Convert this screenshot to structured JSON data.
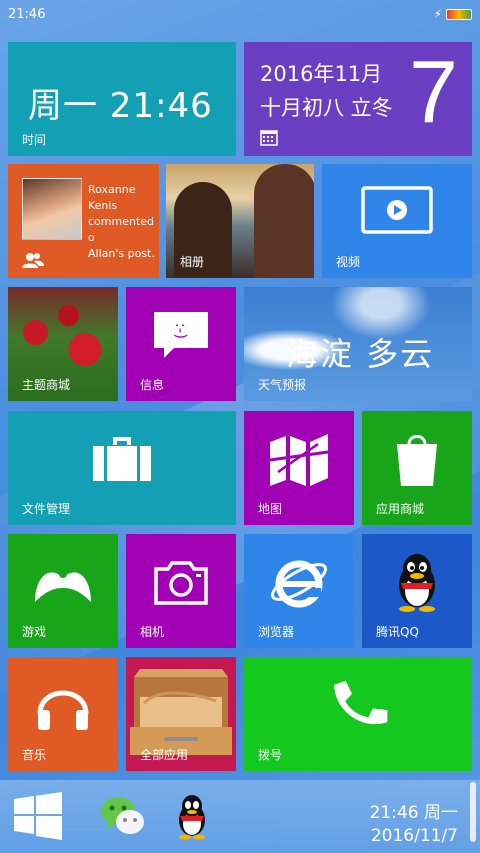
{
  "status": {
    "time": "21:46"
  },
  "tiles": {
    "clock": {
      "time": "周一  21:46",
      "label": "时间"
    },
    "calendar": {
      "line1": "2016年11月",
      "line2": "十月初八 立冬",
      "day": "7"
    },
    "people": {
      "text_line1": "Roxanne Kenis",
      "text_line2": "commented o",
      "text_line3": "Allan's post."
    },
    "photos": {
      "label": "相册"
    },
    "video": {
      "label": "视频"
    },
    "theme": {
      "label": "主题商城"
    },
    "messages": {
      "label": "信息"
    },
    "weather": {
      "text": "海淀  多云",
      "label": "天气预报"
    },
    "files": {
      "label": "文件管理"
    },
    "maps": {
      "label": "地图"
    },
    "store": {
      "label": "应用商城"
    },
    "games": {
      "label": "游戏"
    },
    "camera": {
      "label": "相机"
    },
    "browser": {
      "label": "浏览器"
    },
    "qq": {
      "label": "腾讯QQ"
    },
    "music": {
      "label": "音乐"
    },
    "all_apps": {
      "label": "全部应用"
    },
    "dialer": {
      "label": "拨号"
    }
  },
  "taskbar": {
    "time": "21:46 周一",
    "date": "2016/11/7",
    "icons": [
      "windows-start-icon",
      "wechat-icon",
      "qq-icon"
    ]
  },
  "colors": {
    "teal": "#14a0b4",
    "purple": "#6b3fc2",
    "orange": "#e05a25",
    "blue": "#2f86e8",
    "magenta": "#a100b4",
    "green": "#19a51a",
    "dark_blue": "#1d58c8",
    "bright_green": "#14c81e"
  }
}
